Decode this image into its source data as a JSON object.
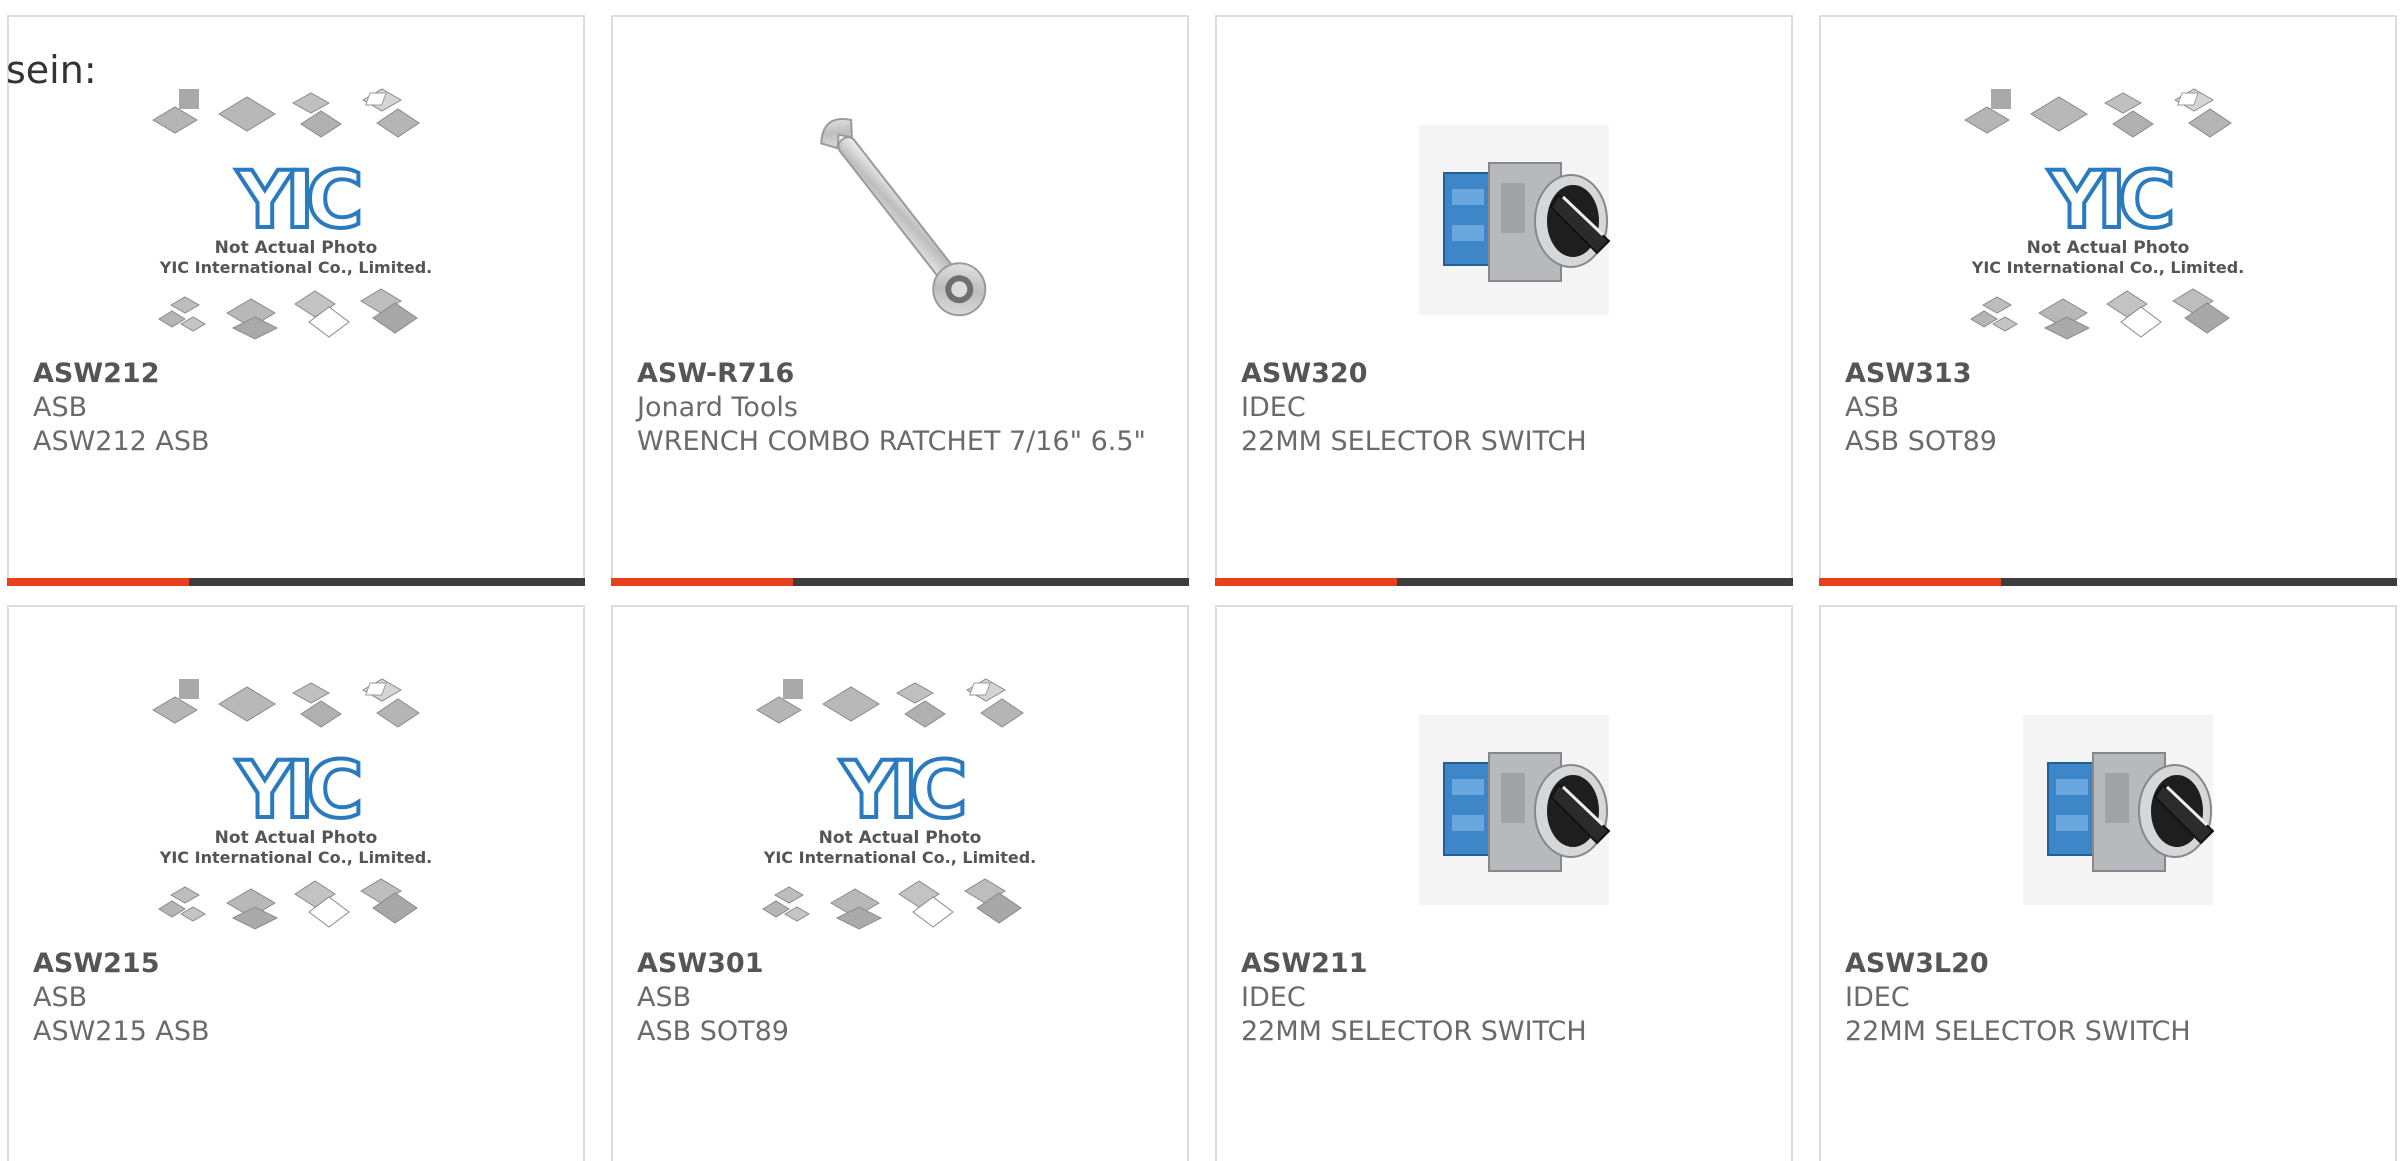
{
  "intro_text": "sein:",
  "watermark": {
    "logo": "YIC",
    "line1": "Not Actual Photo",
    "line2": "YIC International Co., Limited."
  },
  "colors": {
    "accent": "#e8401c",
    "bar": "#3d3d3d",
    "border": "#dddddd"
  },
  "products": [
    {
      "part": "ASW212",
      "manufacturer": "ASB",
      "description": "ASW212 ASB",
      "image": "placeholder-image",
      "link_label": "ASW212"
    },
    {
      "part": "ASW-R716",
      "manufacturer": "Jonard Tools",
      "description": "WRENCH COMBO RATCHET 7/16\" 6.5\"",
      "image": "wrench-image"
    },
    {
      "part": "ASW320",
      "manufacturer": "IDEC",
      "description": "22MM SELECTOR SWITCH",
      "image": "selector-switch-image"
    },
    {
      "part": "ASW313",
      "manufacturer": "ASB",
      "description": "ASB SOT89",
      "image": "placeholder-image"
    },
    {
      "part": "ASW215",
      "manufacturer": "ASB",
      "description": "ASW215 ASB",
      "image": "placeholder-image"
    },
    {
      "part": "ASW301",
      "manufacturer": "ASB",
      "description": "ASB SOT89",
      "image": "placeholder-image"
    },
    {
      "part": "ASW211",
      "manufacturer": "IDEC",
      "description": "22MM SELECTOR SWITCH",
      "image": "selector-switch-image"
    },
    {
      "part": "ASW3L20",
      "manufacturer": "IDEC",
      "description": "22MM SELECTOR SWITCH",
      "image": "selector-switch-image"
    }
  ]
}
